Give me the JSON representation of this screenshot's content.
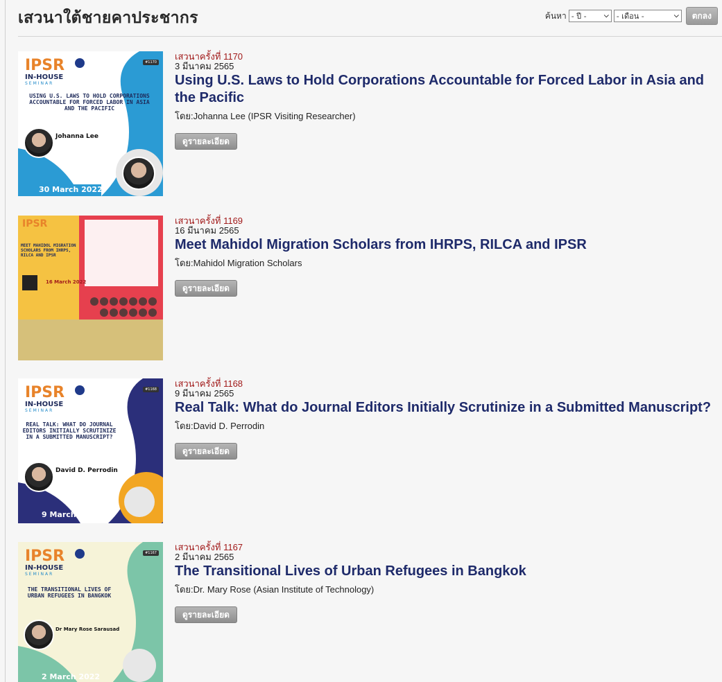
{
  "header": {
    "title": "เสวนาใต้ชายคาประชากร",
    "search_label": "ค้นหา",
    "year_select": "- ปี -",
    "month_select": "- เดือน -",
    "ok_button": "ตกลง"
  },
  "seminars": [
    {
      "number": "เสวนาครั้งที่ 1170",
      "date": "3 มีนาคม 2565",
      "title": "Using U.S. Laws to Hold Corporations Accountable for Forced Labor in Asia and the Pacific",
      "by": "โดย:Johanna Lee (IPSR Visiting Researcher)",
      "detail_button": "ดูรายละเอียด",
      "poster": {
        "headline": "USING U.S. LAWS TO HOLD CORPORATIONS ACCOUNTABLE FOR FORCED LABOR IN ASIA AND THE PACIFIC",
        "speaker": "Johanna Lee",
        "date": "30 March 2022",
        "tag": "#1170",
        "bg": "#2b9bd4",
        "accent": "#f4c84a"
      }
    },
    {
      "number": "เสวนาครั้งที่ 1169",
      "date": "16 มีนาคม 2565",
      "title": "Meet Mahidol Migration Scholars from IHRPS, RILCA and IPSR",
      "by": "โดย:Mahidol Migration Scholars",
      "detail_button": "ดูรายละเอียด",
      "poster": {
        "headline": "MEET MAHIDOL MIGRATION SCHOLARS FROM IHRPS, RILCA AND IPSR",
        "speaker": "",
        "date": "16 March 2022",
        "tag": "",
        "bg": "#e6404e",
        "accent": "#f5c242"
      }
    },
    {
      "number": "เสวนาครั้งที่ 1168",
      "date": "9 มีนาคม 2565",
      "title": "Real Talk: What do Journal Editors Initially Scrutinize in a Submitted Manuscript?",
      "by": "โดย:David D. Perrodin",
      "detail_button": "ดูรายละเอียด",
      "poster": {
        "headline": "REAL TALK: WHAT DO JOURNAL EDITORS INITIALLY SCRUTINIZE IN A SUBMITTED MANUSCRIPT?",
        "speaker": "David D. Perrodin",
        "date": "9 March 2022",
        "tag": "#1168",
        "bg": "#2b2f7a",
        "accent": "#f2a623"
      }
    },
    {
      "number": "เสวนาครั้งที่ 1167",
      "date": "2 มีนาคม 2565",
      "title": "The Transitional Lives of Urban Refugees in Bangkok",
      "by": "โดย:Dr. Mary Rose (Asian Institute of Technology)",
      "detail_button": "ดูรายละเอียด",
      "poster": {
        "headline": "THE TRANSITIONAL LIVES OF URBAN REFUGEES IN BANGKOK",
        "speaker": "Dr Mary Rose Sarausad",
        "date": "2 March 2022",
        "tag": "#1167",
        "bg": "#7cc5a8",
        "accent": "#f6e7a0"
      }
    }
  ]
}
